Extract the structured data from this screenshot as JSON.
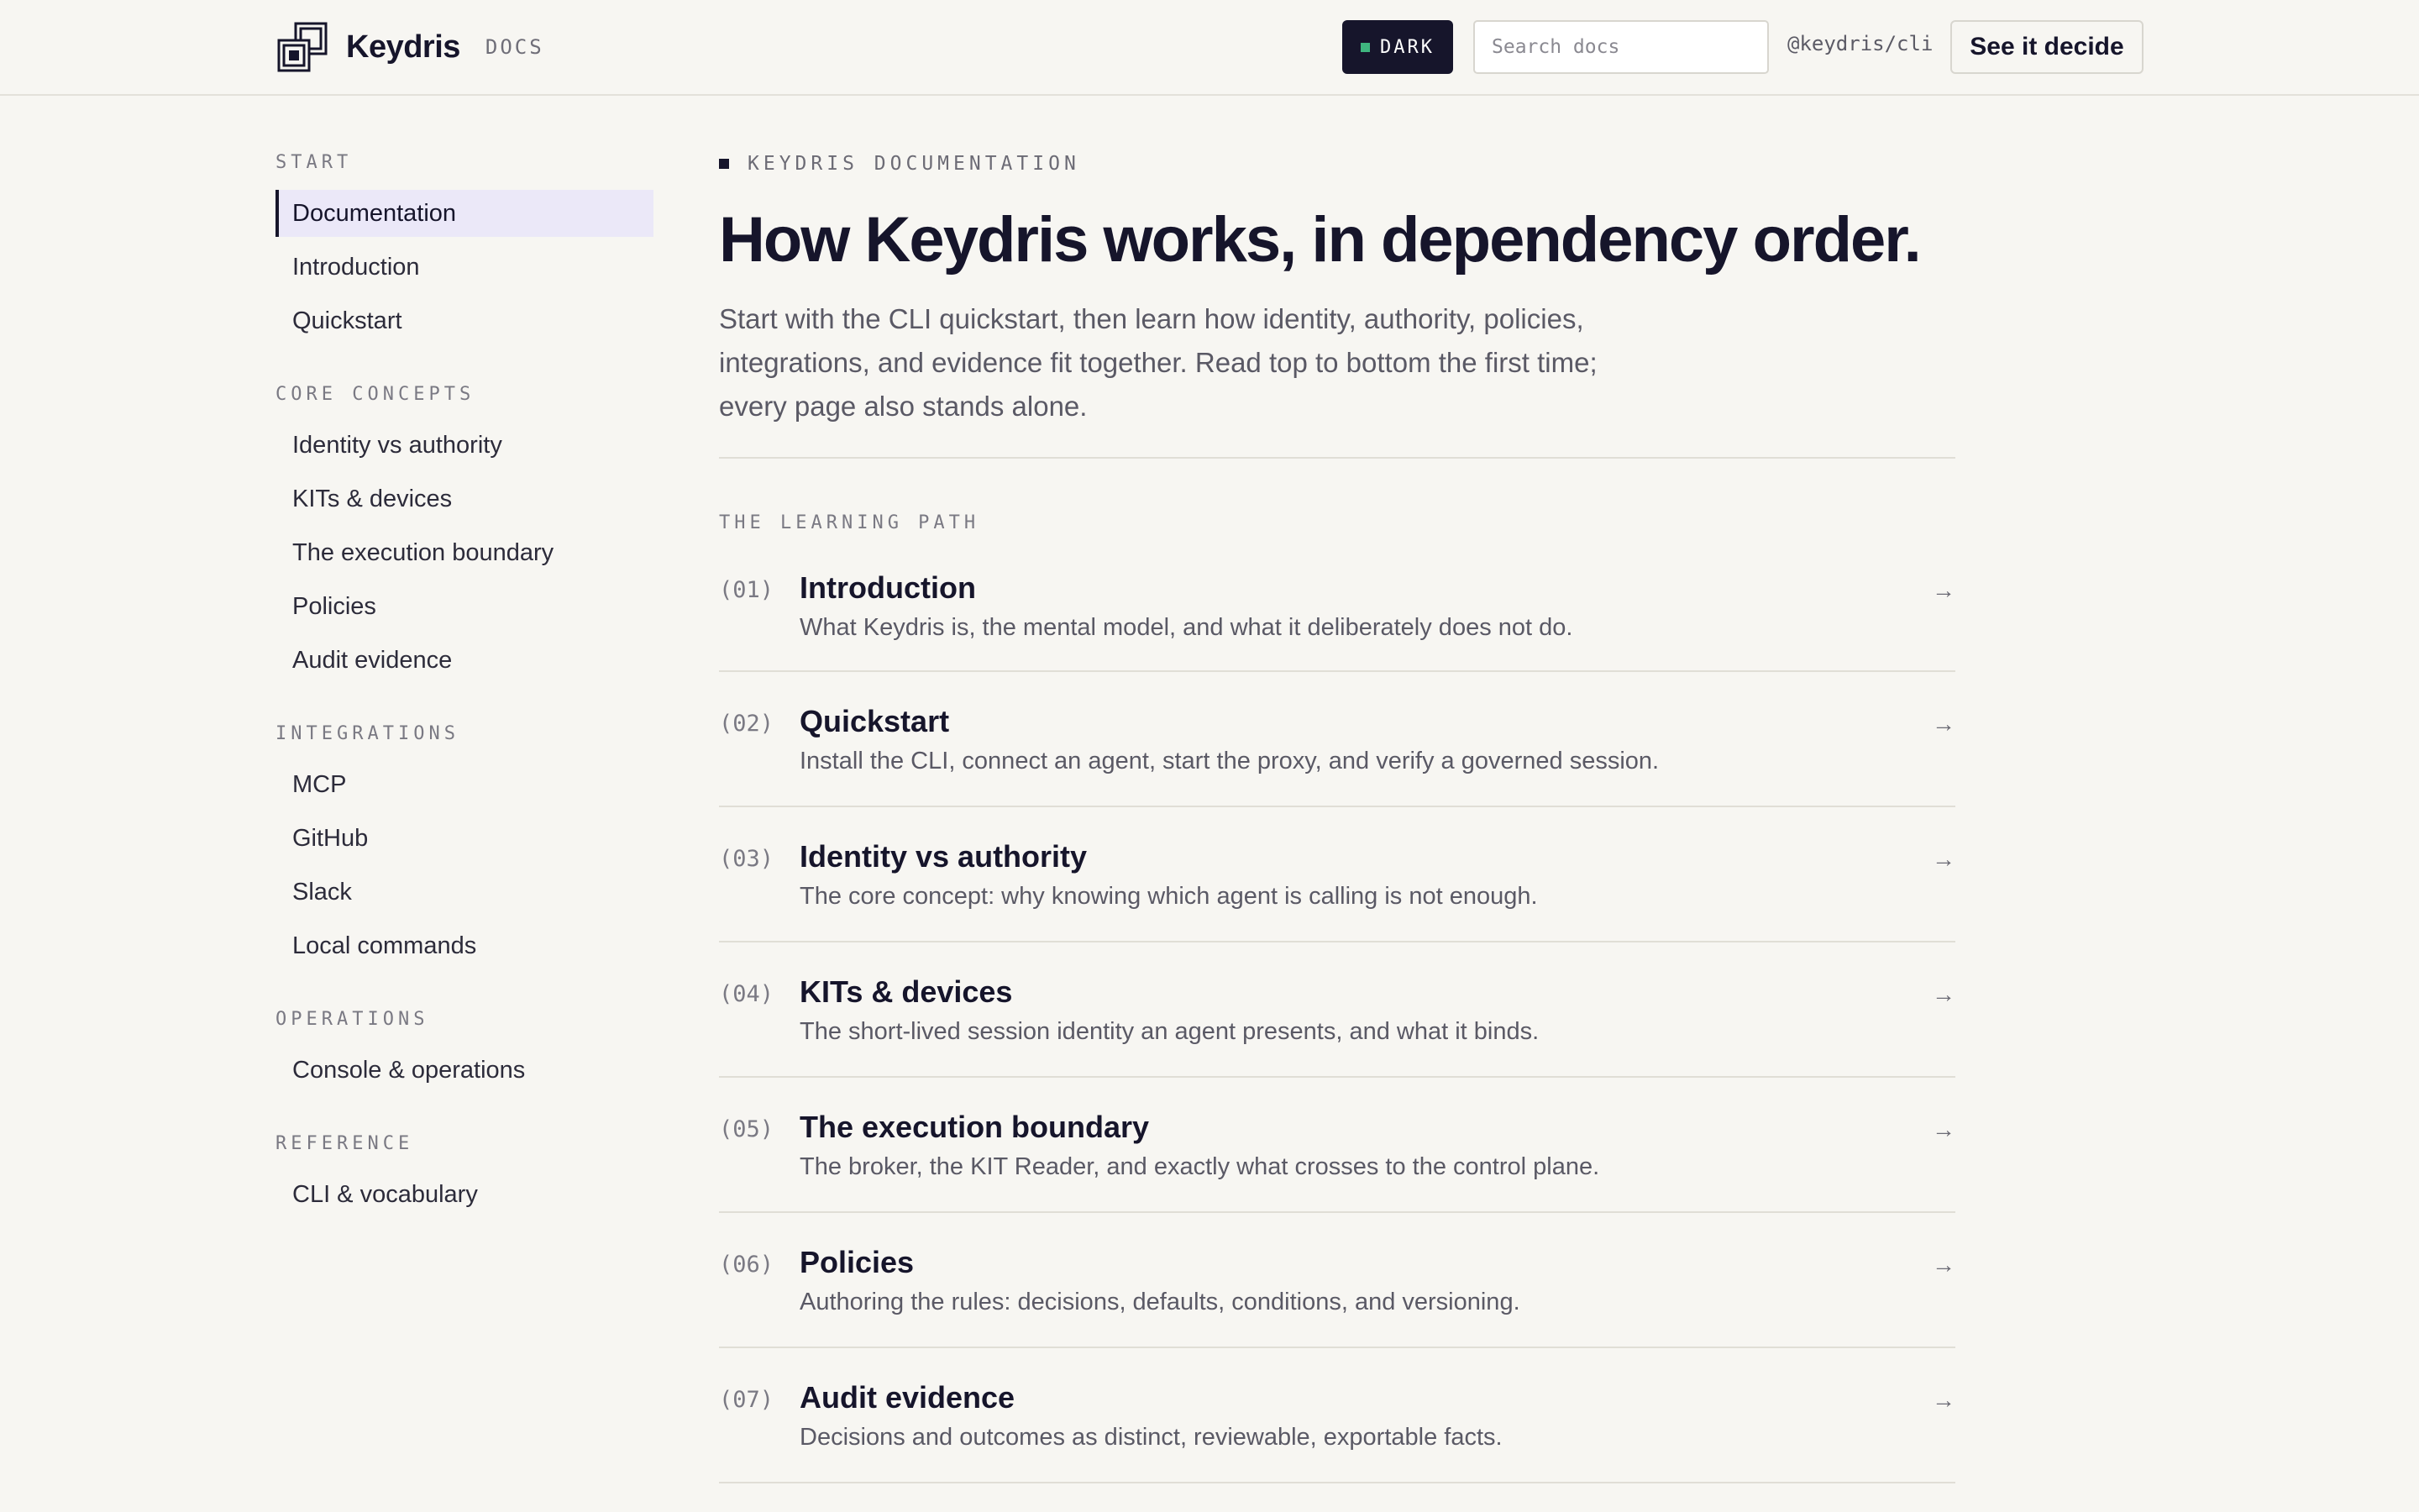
{
  "header": {
    "brand_name": "Keydris",
    "brand_tag": "DOCS",
    "theme_toggle_label": "DARK",
    "search_placeholder": "Search docs",
    "package_link": "@keydris/cli",
    "cta_label": "See it decide"
  },
  "sidebar": {
    "sections": [
      {
        "title": "START",
        "items": [
          "Documentation",
          "Introduction",
          "Quickstart"
        ]
      },
      {
        "title": "CORE CONCEPTS",
        "items": [
          "Identity vs authority",
          "KITs & devices",
          "The execution boundary",
          "Policies",
          "Audit evidence"
        ]
      },
      {
        "title": "INTEGRATIONS",
        "items": [
          "MCP",
          "GitHub",
          "Slack",
          "Local commands"
        ]
      },
      {
        "title": "OPERATIONS",
        "items": [
          "Console & operations"
        ]
      },
      {
        "title": "REFERENCE",
        "items": [
          "CLI & vocabulary"
        ]
      }
    ],
    "active_item": "Documentation"
  },
  "main": {
    "eyebrow": "KEYDRIS DOCUMENTATION",
    "title": "How Keydris works, in dependency order.",
    "intro": "Start with the CLI quickstart, then learn how identity, authority, policies, integrations, and evidence fit together. Read top to bottom the first time; every page also stands alone.",
    "path_title": "THE LEARNING PATH",
    "path": [
      {
        "num": "(01)",
        "name": "Introduction",
        "desc": "What Keydris is, the mental model, and what it deliberately does not do.",
        "arrow": "→"
      },
      {
        "num": "(02)",
        "name": "Quickstart",
        "desc": "Install the CLI, connect an agent, start the proxy, and verify a governed session.",
        "arrow": "→"
      },
      {
        "num": "(03)",
        "name": "Identity vs authority",
        "desc": "The core concept: why knowing which agent is calling is not enough.",
        "arrow": "→"
      },
      {
        "num": "(04)",
        "name": "KITs & devices",
        "desc": "The short-lived session identity an agent presents, and what it binds.",
        "arrow": "→"
      },
      {
        "num": "(05)",
        "name": "The execution boundary",
        "desc": "The broker, the KIT Reader, and exactly what crosses to the control plane.",
        "arrow": "→"
      },
      {
        "num": "(06)",
        "name": "Policies",
        "desc": "Authoring the rules: decisions, defaults, conditions, and versioning.",
        "arrow": "→"
      },
      {
        "num": "(07)",
        "name": "Audit evidence",
        "desc": "Decisions and outcomes as distinct, reviewable, exportable facts.",
        "arrow": "→"
      }
    ]
  },
  "colors": {
    "background": "#f7f6f2",
    "ink": "#16152b",
    "active_bg": "#ebe8f8",
    "toggle_dot": "#3fb67f"
  }
}
